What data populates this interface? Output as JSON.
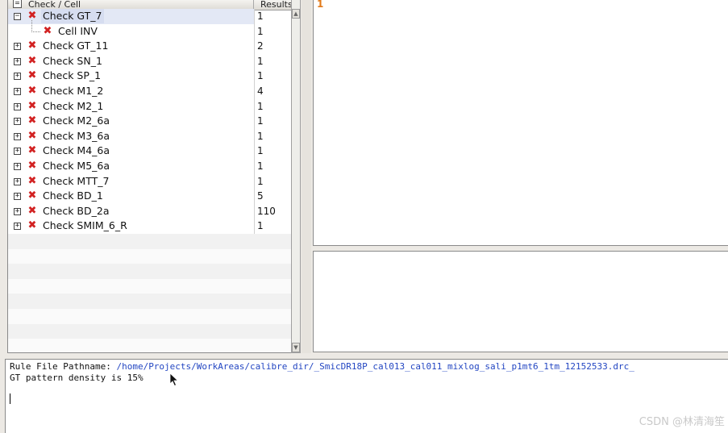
{
  "tree": {
    "header": {
      "check_label": "Check / Cell",
      "results_label": "Results"
    },
    "rows": [
      {
        "name": "Check GT_7",
        "results": "1",
        "expanded": true,
        "selected": true,
        "level": 0
      },
      {
        "name": "Cell INV",
        "results": "1",
        "level": 1
      },
      {
        "name": "Check GT_11",
        "results": "2",
        "level": 0
      },
      {
        "name": "Check SN_1",
        "results": "1",
        "level": 0
      },
      {
        "name": "Check SP_1",
        "results": "1",
        "level": 0
      },
      {
        "name": "Check M1_2",
        "results": "4",
        "level": 0
      },
      {
        "name": "Check M2_1",
        "results": "1",
        "level": 0
      },
      {
        "name": "Check M2_6a",
        "results": "1",
        "level": 0
      },
      {
        "name": "Check M3_6a",
        "results": "1",
        "level": 0
      },
      {
        "name": "Check M4_6a",
        "results": "1",
        "level": 0
      },
      {
        "name": "Check M5_6a",
        "results": "1",
        "level": 0
      },
      {
        "name": "Check MTT_7",
        "results": "1",
        "level": 0
      },
      {
        "name": "Check BD_1",
        "results": "5",
        "level": 0
      },
      {
        "name": "Check BD_2a",
        "results": "110",
        "level": 0
      },
      {
        "name": "Check SMIM_6_R",
        "results": "1",
        "level": 0
      }
    ]
  },
  "detail": {
    "first_line_number": "1"
  },
  "log": {
    "pathname_label": "Rule File Pathname: ",
    "pathname_value": "/home/Projects/WorkAreas/calibre_dir/_SmicDR18P_cal013_cal011_mixlog_sali_p1mt6_1tm_12152533.drc_",
    "line2": "GT pattern density is 15%"
  },
  "watermark": "CSDN @林清海笙",
  "colors": {
    "error_mark": "#d22222",
    "path_link": "#2346c2",
    "selection": "#d6ddf0",
    "line_number": "#e27a1a"
  }
}
